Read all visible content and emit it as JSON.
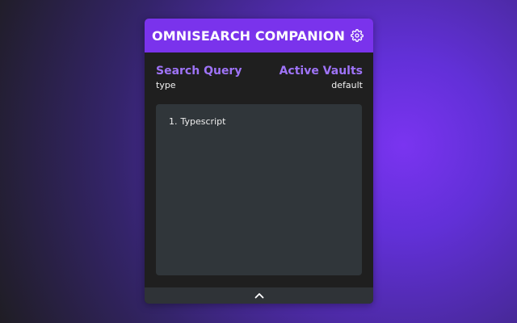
{
  "header": {
    "title": "OMNISEARCH COMPANION",
    "settings_icon": "gear-icon"
  },
  "search": {
    "label": "Search Query",
    "value": "type"
  },
  "vaults": {
    "label": "Active Vaults",
    "value": "default"
  },
  "results": [
    {
      "index": "1.",
      "label": "Typescript"
    }
  ],
  "footer": {
    "toggle_icon": "chevron-up-icon"
  },
  "colors": {
    "accent": "#7a33ec",
    "label": "#9e73f7",
    "panel": "#1f1f1f",
    "results_bg": "#30363a"
  }
}
